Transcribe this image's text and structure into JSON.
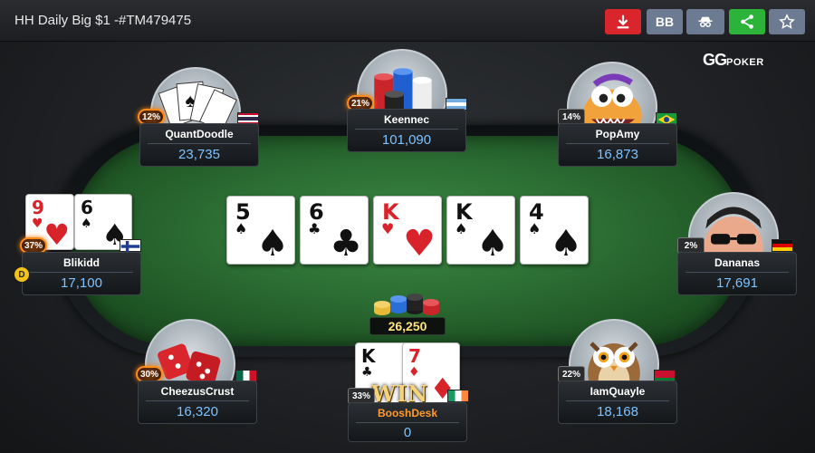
{
  "window": {
    "title": "HH Daily Big $1 -#TM479475"
  },
  "toolbar": {
    "bb_label": "BB"
  },
  "brand": {
    "gg": "GG",
    "poker": "POKER"
  },
  "board": [
    {
      "rank": "5",
      "suit": "♠",
      "color": "black"
    },
    {
      "rank": "6",
      "suit": "♣",
      "color": "black"
    },
    {
      "rank": "K",
      "suit": "♥",
      "color": "red"
    },
    {
      "rank": "K",
      "suit": "♠",
      "color": "black"
    },
    {
      "rank": "4",
      "suit": "♠",
      "color": "black"
    }
  ],
  "pot": {
    "amount": "26,250"
  },
  "players": {
    "quantdoodle": {
      "name": "QuantDoodle",
      "stack": "23,735",
      "pct": "12%"
    },
    "keennec": {
      "name": "Keennec",
      "stack": "101,090",
      "pct": "21%"
    },
    "popamy": {
      "name": "PopAmy",
      "stack": "16,873",
      "pct": "14%"
    },
    "blikidd": {
      "name": "Blikidd",
      "stack": "17,100",
      "pct": "37%",
      "cards": [
        {
          "rank": "9",
          "suit": "♥"
        },
        {
          "rank": "6",
          "suit": "♠"
        }
      ]
    },
    "dananas": {
      "name": "Dananas",
      "stack": "17,691",
      "pct": "2%"
    },
    "cheezus": {
      "name": "CheezusCrust",
      "stack": "16,320",
      "pct": "30%"
    },
    "booshdesk": {
      "name": "BooshDesk",
      "stack": "0",
      "pct": "33%",
      "win": "WIN",
      "cards": [
        {
          "rank": "K",
          "suit": "♣"
        },
        {
          "rank": "7",
          "suit": "♦"
        }
      ]
    },
    "iamquayle": {
      "name": "IamQuayle",
      "stack": "18,168",
      "pct": "22%"
    }
  },
  "dealer_button": "D",
  "colors": {
    "felt": "#2a6b31",
    "stack_blue": "#7cc2ff",
    "pot_gold": "#ffe37a",
    "winner_orange": "#ff9a2e"
  }
}
